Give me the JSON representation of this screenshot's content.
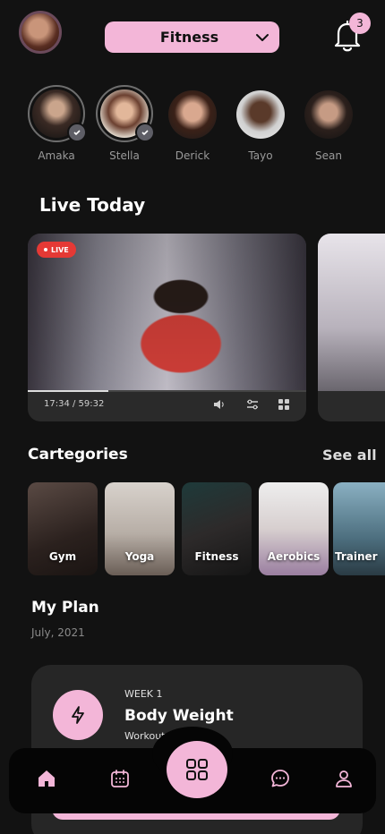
{
  "header": {
    "category_selector": "Fitness",
    "notification_count": "3"
  },
  "stories": [
    {
      "name": "Amaka",
      "seen": true
    },
    {
      "name": "Stella",
      "seen": true
    },
    {
      "name": "Derick",
      "seen": false
    },
    {
      "name": "Tayo",
      "seen": false
    },
    {
      "name": "Sean",
      "seen": false
    }
  ],
  "live": {
    "title": "Live Today",
    "badge": "LIVE",
    "time": "17:34 / 59:32",
    "progress": 0.29
  },
  "categories": {
    "title": "Cartegories",
    "see_all": "See all",
    "items": [
      "Gym",
      "Yoga",
      "Fitness",
      "Aerobics",
      "Trainer"
    ]
  },
  "plan": {
    "title": "My Plan",
    "date": "July, 2021",
    "week": "WEEK 1",
    "name": "Body Weight",
    "subtitle": "Workout 1"
  },
  "colors": {
    "accent": "#f3b6d8",
    "background": "#121212",
    "live": "#e53935"
  }
}
